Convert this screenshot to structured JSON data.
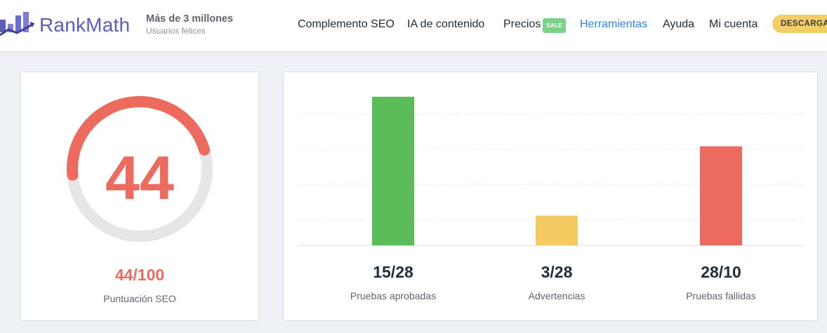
{
  "header": {
    "brand": "RankMath",
    "tagline_main": "Más de 3 millones",
    "tagline_sub": "Usuarios felices",
    "nav": [
      {
        "label": "Complemento SEO"
      },
      {
        "label": "IA de contenido"
      },
      {
        "label": "Precios"
      },
      {
        "label": "Herramientas"
      },
      {
        "label": "Ayuda"
      },
      {
        "label": "Mi cuenta"
      }
    ],
    "sale_badge": "SALE",
    "download_label": "DESCARGAR"
  },
  "score": {
    "value": "44",
    "fraction": "44/100",
    "label": "Puntuación SEO",
    "progress": 0.44
  },
  "colors": {
    "score": "#ed6a5e",
    "track": "#e6e6e6",
    "passed": "#5bbd59",
    "warnings": "#f5ca63",
    "failed": "#ed6a5e",
    "accent": "#2e86de"
  },
  "chart_data": {
    "type": "bar",
    "categories": [
      "Pruebas aprobadas",
      "Advertencias",
      "Pruebas fallidas"
    ],
    "values": [
      15,
      3,
      10
    ],
    "value_labels": [
      "15/28",
      "3/28",
      "28/10"
    ],
    "ylim": [
      0,
      15
    ],
    "grid": true
  }
}
